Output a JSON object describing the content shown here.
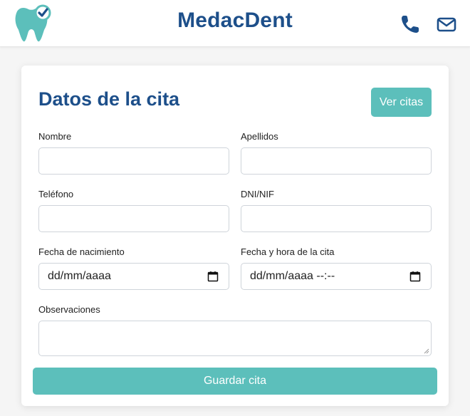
{
  "header": {
    "brand": "MedacDent",
    "icons": [
      "tooth-check-logo",
      "phone-icon",
      "mail-icon"
    ]
  },
  "form": {
    "title": "Datos de la cita",
    "view_button": "Ver citas",
    "fields": {
      "nombre": {
        "label": "Nombre",
        "value": ""
      },
      "apellidos": {
        "label": "Apellidos",
        "value": ""
      },
      "telefono": {
        "label": "Teléfono",
        "value": ""
      },
      "dni": {
        "label": "DNI/NIF",
        "value": ""
      },
      "nacimiento": {
        "label": "Fecha de nacimiento",
        "value": "dd/mm/aaaa"
      },
      "cita": {
        "label": "Fecha y hora de la cita",
        "value": "dd/mm/aaaa --:--"
      },
      "observaciones": {
        "label": "Observaciones",
        "value": ""
      }
    },
    "save_button": "Guardar cita"
  },
  "colors": {
    "brand_blue": "#1d4f8a",
    "teal": "#5cbfbb",
    "background": "#f5f5f5"
  }
}
